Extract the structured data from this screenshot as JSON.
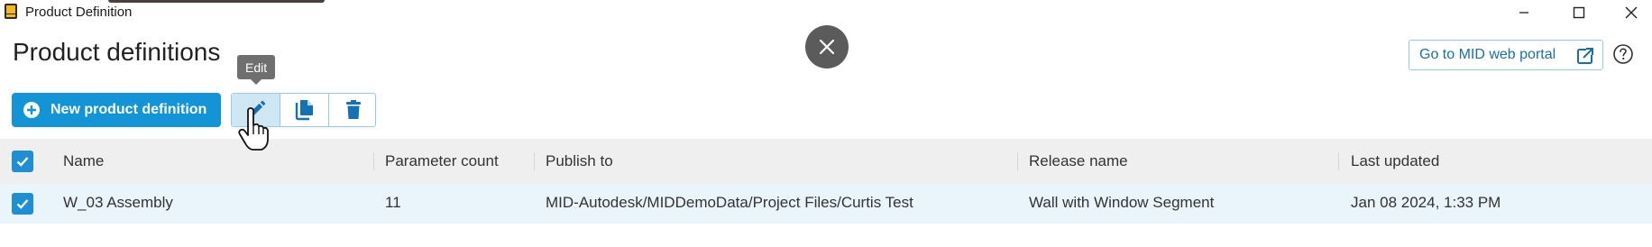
{
  "window": {
    "title": "Product Definition",
    "icons": {
      "app": "autodesk-app-icon",
      "minimize": "minimize-icon",
      "maximize": "maximize-icon",
      "close": "close-icon"
    }
  },
  "page": {
    "title": "Product definitions",
    "portal_button_label": "Go to MID web portal",
    "portal_icon": "external-link-icon",
    "help_icon": "help-icon"
  },
  "overlay": {
    "close_icon": "close-icon"
  },
  "toolbar": {
    "new_button_label": "New product definition",
    "new_icon": "plus-circle-icon",
    "edit_icon": "pencil-icon",
    "copy_icon": "copy-icon",
    "delete_icon": "trash-icon",
    "tooltip": "Edit"
  },
  "table": {
    "columns": [
      "Name",
      "Parameter count",
      "Publish to",
      "Release name",
      "Last updated"
    ],
    "header_checked": true,
    "rows": [
      {
        "checked": true,
        "name": "W_03 Assembly",
        "parameter_count": "11",
        "publish_to": "MID-Autodesk/MIDDemoData/Project Files/Curtis Test",
        "release_name": "Wall with Window Segment",
        "last_updated": "Jan 08 2024, 1:33 PM"
      }
    ]
  },
  "colors": {
    "accent": "#1294d6",
    "checkbox": "#1f8fd5",
    "header_bg": "#efefef",
    "selected_row_bg": "#e9f4fb",
    "outline": "#9bc9e6",
    "link_text": "#1a6fa5",
    "tooltip_bg": "#6f6f6f",
    "overlay_close_bg": "#5b5b5b"
  }
}
